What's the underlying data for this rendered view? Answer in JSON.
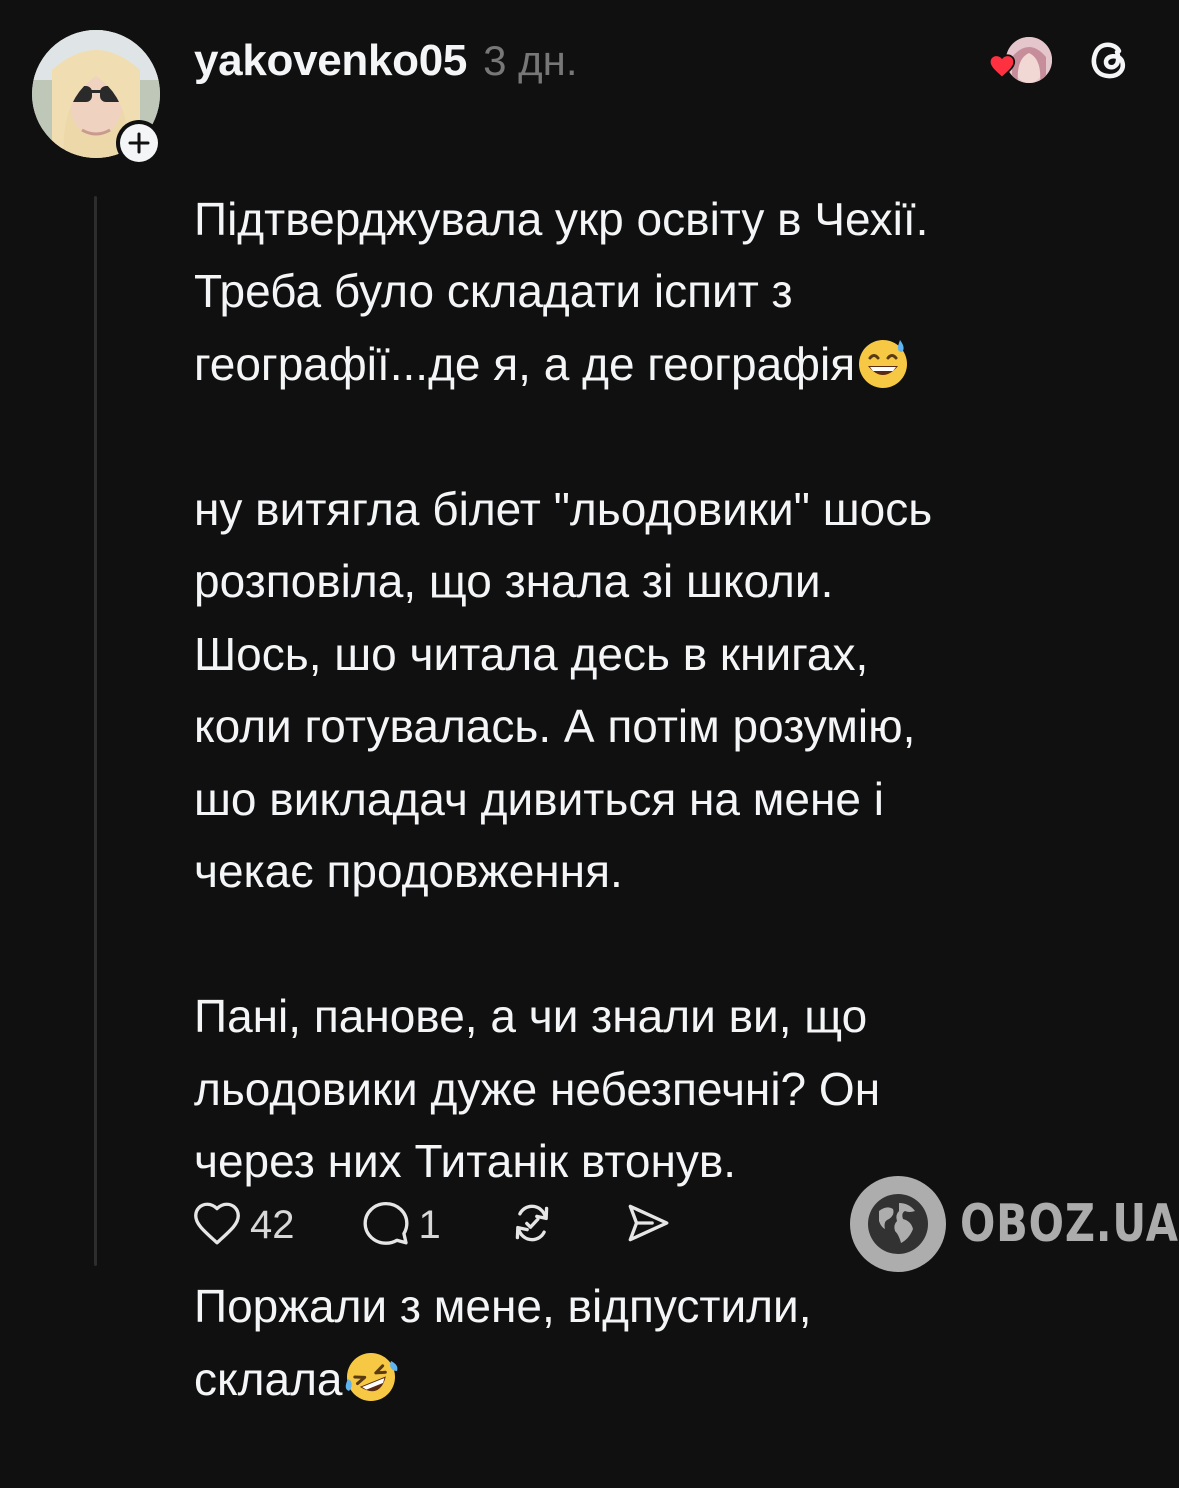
{
  "post": {
    "username": "yakovenko05",
    "time": "3 дн.",
    "paragraphs": [
      {
        "lines": [
          "Підтверджувала укр освіту в Чехії.",
          "Треба було складати іспит з",
          "географії...де я, а де географія"
        ],
        "emoji_after_last": "grinning-sweat-emoji"
      },
      {
        "lines": [
          "ну витягла білет \"льодовики\"  шось",
          "розповіла, що знала зі школи.",
          "Шось, шо читала десь в книгах,",
          "коли готувалась. А потім розумію,",
          "шо викладач дивиться на мене і",
          "чекає продовження."
        ]
      },
      {
        "lines": [
          "Пані, панове, а чи знали ви, що",
          "льодовики дуже небезпечні? Он",
          "через них Титанік втонув."
        ]
      },
      {
        "lines": [
          "Поржали з мене, відпустили,",
          "склала"
        ],
        "emoji_after_last": "rolling-laughing-emoji"
      }
    ],
    "actions": {
      "likes": "42",
      "replies": "1"
    }
  },
  "icons": {
    "follow": "plus-icon",
    "liked_by": "heart-icon",
    "app": "threads-logo-icon",
    "like": "heart-outline-icon",
    "reply": "comment-icon",
    "repost": "repost-icon",
    "share": "send-icon",
    "watermark": "globe-icon"
  },
  "watermark": {
    "brand": "OBOZ.UA"
  },
  "colors": {
    "background": "#101010",
    "text": "#f3f5f7",
    "secondary": "#777777",
    "heart_red": "#ff3040"
  }
}
